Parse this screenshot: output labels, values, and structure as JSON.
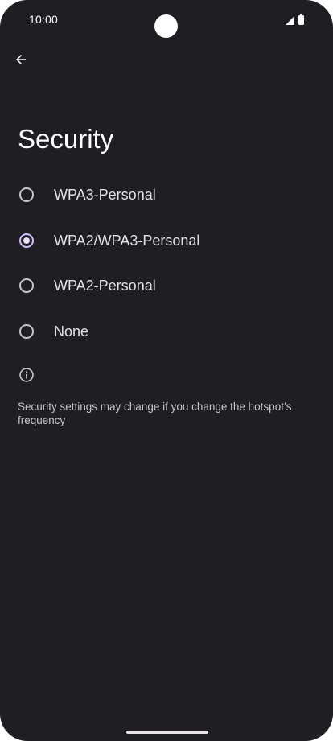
{
  "status_bar": {
    "time": "10:00",
    "icons": [
      "signal-icon",
      "battery-icon"
    ]
  },
  "header": {
    "back_icon": "arrow-left-icon",
    "title": "Security"
  },
  "security_options": [
    {
      "label": "WPA3-Personal",
      "selected": false
    },
    {
      "label": "WPA2/WPA3-Personal",
      "selected": true
    },
    {
      "label": "WPA2-Personal",
      "selected": false
    },
    {
      "label": "None",
      "selected": false
    }
  ],
  "info": {
    "icon": "info-icon",
    "text": "Security settings may change if you change the hotspot’s frequency"
  },
  "colors": {
    "background": "#1f1e23",
    "accent": "#d0bcff",
    "text_primary": "#e6e1e5",
    "text_secondary": "#c9c5ca"
  }
}
